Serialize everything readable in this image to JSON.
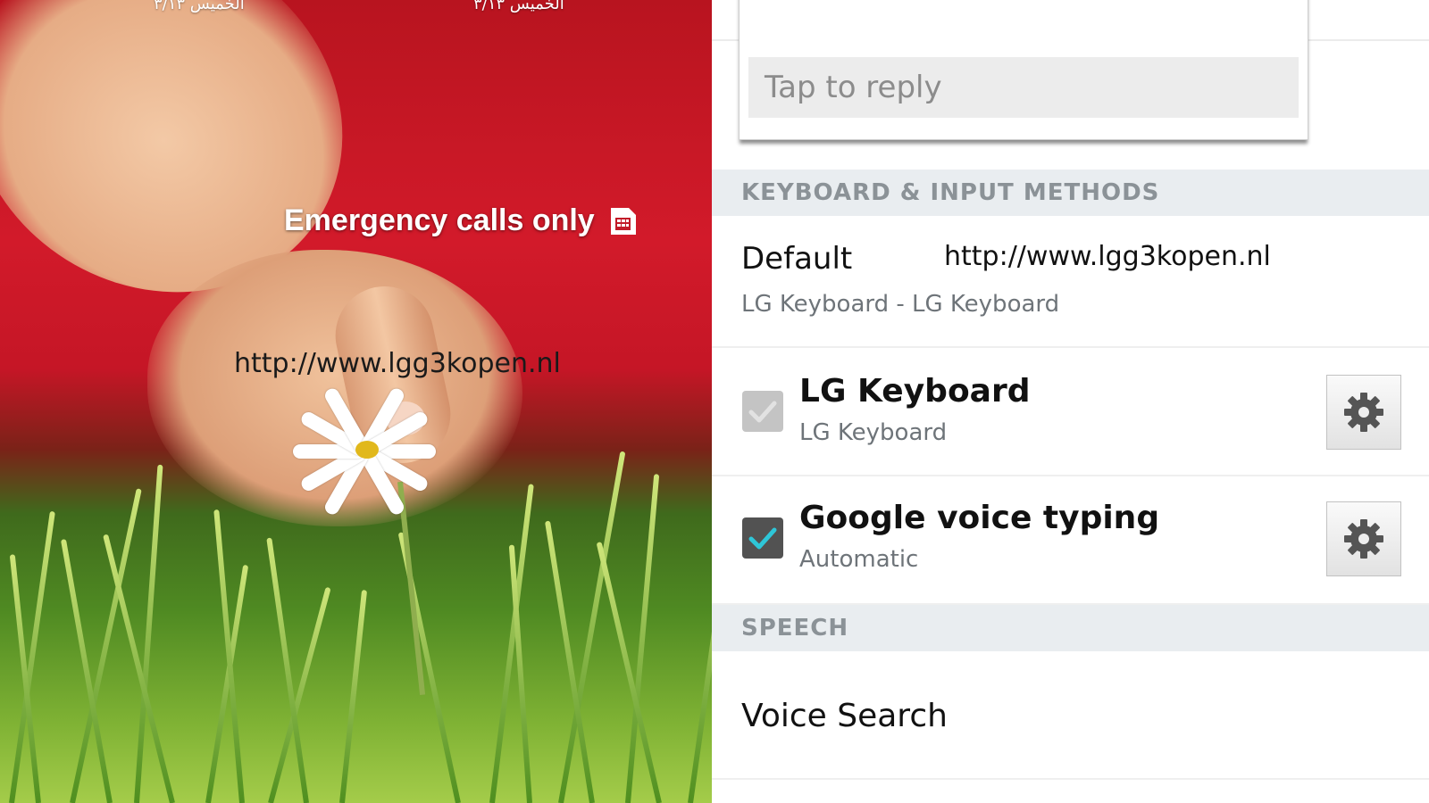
{
  "lock_screen": {
    "date_left": "الخميس ٣/١٣",
    "date_right": "الخميس ٣/١٣",
    "status": "Emergency calls only",
    "status_icon": "sim-card-icon",
    "watermark": "http://www.lgg3kopen.nl"
  },
  "reply_popup": {
    "placeholder": "Tap to reply"
  },
  "keyboard_section": {
    "header": "KEYBOARD & INPUT METHODS",
    "default": {
      "title": "Default",
      "subtitle": "LG Keyboard - LG Keyboard",
      "watermark": "http://www.lgg3kopen.nl"
    },
    "items": [
      {
        "title": "LG Keyboard",
        "subtitle": "LG Keyboard",
        "checked": true,
        "enabled": false,
        "icon": "gear-icon"
      },
      {
        "title": "Google voice typing",
        "subtitle": "Automatic",
        "checked": true,
        "enabled": true,
        "icon": "gear-icon"
      }
    ]
  },
  "speech_section": {
    "header": "SPEECH",
    "items": [
      {
        "title": "Voice Search"
      }
    ]
  },
  "colors": {
    "check_accent": "#2ec6d8",
    "header_bg": "#e9edf0",
    "header_text": "#8b9297"
  }
}
